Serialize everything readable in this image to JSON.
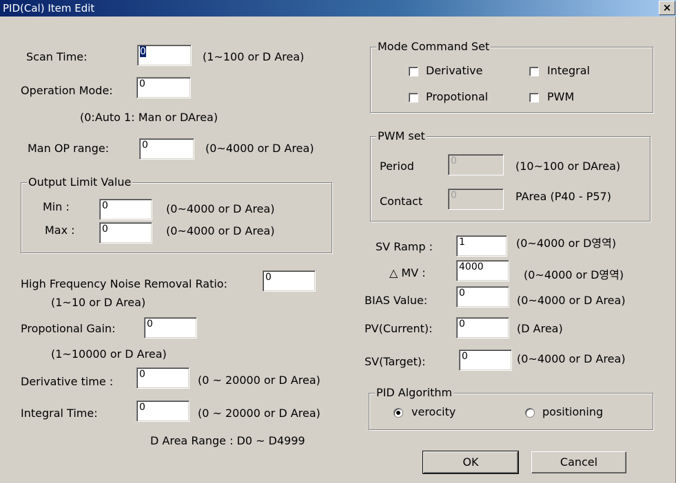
{
  "window": {
    "title": "PID(Cal) Item Edit",
    "close_glyph": "×"
  },
  "scan_time": {
    "label": "Scan Time:",
    "value": "0",
    "hint": "(1~100 or D Area)"
  },
  "operation_mode": {
    "label": "Operation Mode:",
    "value": "0",
    "hint": "(0:Auto 1: Man or DArea)"
  },
  "man_op_range": {
    "label": "Man OP range:",
    "value": "0",
    "hint": "(0~4000 or D Area)"
  },
  "output_limit": {
    "title": "Output Limit Value",
    "min": {
      "label": "Min :",
      "value": "0",
      "hint": "(0~4000 or D Area)"
    },
    "max": {
      "label": "Max :",
      "value": "0",
      "hint": "(0~4000 or D Area)"
    }
  },
  "hf_noise": {
    "label": "High Frequency Noise Removal Ratio:",
    "value": "0",
    "hint": "(1~10 or D Area)"
  },
  "prop_gain": {
    "label": "Propotional Gain:",
    "value": "0",
    "hint": "(1~10000  or D Area)"
  },
  "derivative_time": {
    "label": "Derivative time :",
    "value": "0",
    "hint": "(0 ~ 20000 or D Area)"
  },
  "integral_time": {
    "label": "Integral Time:",
    "value": "0",
    "hint": "(0 ~ 20000 or D Area)"
  },
  "d_area_range": "D Area Range : D0 ~ D4999",
  "mode_command": {
    "title": "Mode Command Set",
    "items": [
      {
        "label": "Derivative",
        "checked": false
      },
      {
        "label": "Integral",
        "checked": false
      },
      {
        "label": "Propotional",
        "checked": false
      },
      {
        "label": "PWM",
        "checked": false
      }
    ]
  },
  "pwm_set": {
    "title": "PWM set",
    "period": {
      "label": "Period",
      "value": "0",
      "hint": "(10~100 or DArea)"
    },
    "contact": {
      "label": "Contact",
      "value": "0",
      "hint": "PArea (P40 - P57)"
    }
  },
  "sv_ramp": {
    "label": "SV Ramp :",
    "value": "1",
    "hint": "(0~4000 or D영역)"
  },
  "delta_mv": {
    "label": "△ MV :",
    "value": "4000",
    "hint": "(0~4000 or D영역)"
  },
  "bias_value": {
    "label": "BIAS Value:",
    "value": "0",
    "hint": "(0~4000 or D Area)"
  },
  "pv_current": {
    "label": "PV(Current):",
    "value": "0",
    "hint": "(D Area)"
  },
  "sv_target": {
    "label": "SV(Target):",
    "value": "0",
    "hint": "(0~4000 or D Area)"
  },
  "pid_algorithm": {
    "title": "PID Algorithm",
    "options": [
      {
        "label": "verocity",
        "selected": true
      },
      {
        "label": "positioning",
        "selected": false
      }
    ]
  },
  "buttons": {
    "ok": "OK",
    "cancel": "Cancel"
  }
}
